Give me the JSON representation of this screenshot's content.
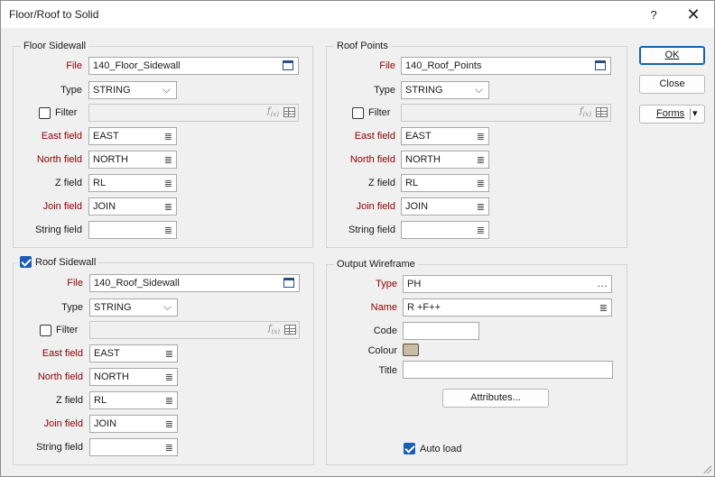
{
  "window": {
    "title": "Floor/Roof to Solid",
    "help_glyph": "?",
    "close_glyph": "✕"
  },
  "floor_sidewall": {
    "title": "Floor Sidewall",
    "file_label": "File",
    "file_value": "140_Floor_Sidewall",
    "type_label": "Type",
    "type_value": "STRING",
    "filter_label": "Filter",
    "filter_checked": false,
    "east_label": "East field",
    "east_value": "EAST",
    "north_label": "North field",
    "north_value": "NORTH",
    "z_label": "Z field",
    "z_value": "RL",
    "join_label": "Join field",
    "join_value": "JOIN",
    "string_label": "String field",
    "string_value": ""
  },
  "roof_points": {
    "title": "Roof Points",
    "file_label": "File",
    "file_value": "140_Roof_Points",
    "type_label": "Type",
    "type_value": "STRING",
    "filter_label": "Filter",
    "filter_checked": false,
    "east_label": "East field",
    "east_value": "EAST",
    "north_label": "North field",
    "north_value": "NORTH",
    "z_label": "Z field",
    "z_value": "RL",
    "join_label": "Join field",
    "join_value": "JOIN",
    "string_label": "String field",
    "string_value": ""
  },
  "roof_sidewall": {
    "title": "Roof Sidewall",
    "enabled": true,
    "file_label": "File",
    "file_value": "140_Roof_Sidewall",
    "type_label": "Type",
    "type_value": "STRING",
    "filter_label": "Filter",
    "filter_checked": false,
    "east_label": "East field",
    "east_value": "EAST",
    "north_label": "North field",
    "north_value": "NORTH",
    "z_label": "Z field",
    "z_value": "RL",
    "join_label": "Join field",
    "join_value": "JOIN",
    "string_label": "String field",
    "string_value": ""
  },
  "output_wireframe": {
    "title": "Output Wireframe",
    "type_label": "Type",
    "type_value": "PH",
    "name_label": "Name",
    "name_value": "R +F++",
    "code_label": "Code",
    "code_value": "",
    "colour_label": "Colour",
    "colour_hex": "#c8bca4",
    "title_label": "Title",
    "title_value": "",
    "attributes_button": "Attributes...",
    "autoload_label": "Auto load",
    "autoload_checked": true
  },
  "buttons": {
    "ok": "OK",
    "close": "Close",
    "forms": "Forms"
  },
  "icons": {
    "list": "≣",
    "dropdown": "⌵",
    "ellipsis": "…",
    "forms_arrow": "▾"
  }
}
